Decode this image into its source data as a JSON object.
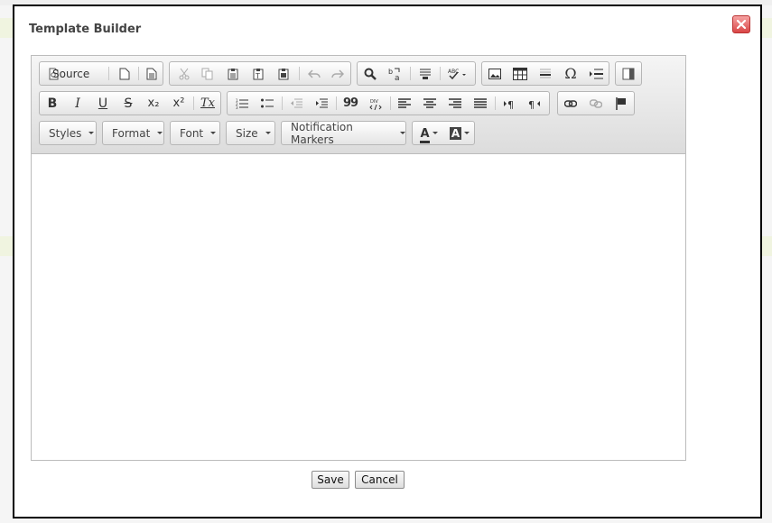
{
  "dialog": {
    "title": "Template Builder"
  },
  "toolbar": {
    "source_label": "Source",
    "styles_label": "Styles",
    "format_label": "Format",
    "font_label": "Font",
    "size_label": "Size",
    "notification_markers_label": "Notification Markers",
    "bold_label": "B",
    "italic_label": "I",
    "underline_label": "U",
    "strike_label": "S",
    "subscript_label": "x₂",
    "superscript_label": "x²",
    "clear_format_label": "Tx",
    "blockquote_label": "99",
    "omega_label": "Ω",
    "text_color_label": "A",
    "bg_color_label": "A"
  },
  "footer": {
    "save_label": "Save",
    "cancel_label": "Cancel"
  },
  "colors": {
    "modal_border": "#000000",
    "close_button": "#d94646",
    "toolbar_bg": "#dcdcdc"
  }
}
